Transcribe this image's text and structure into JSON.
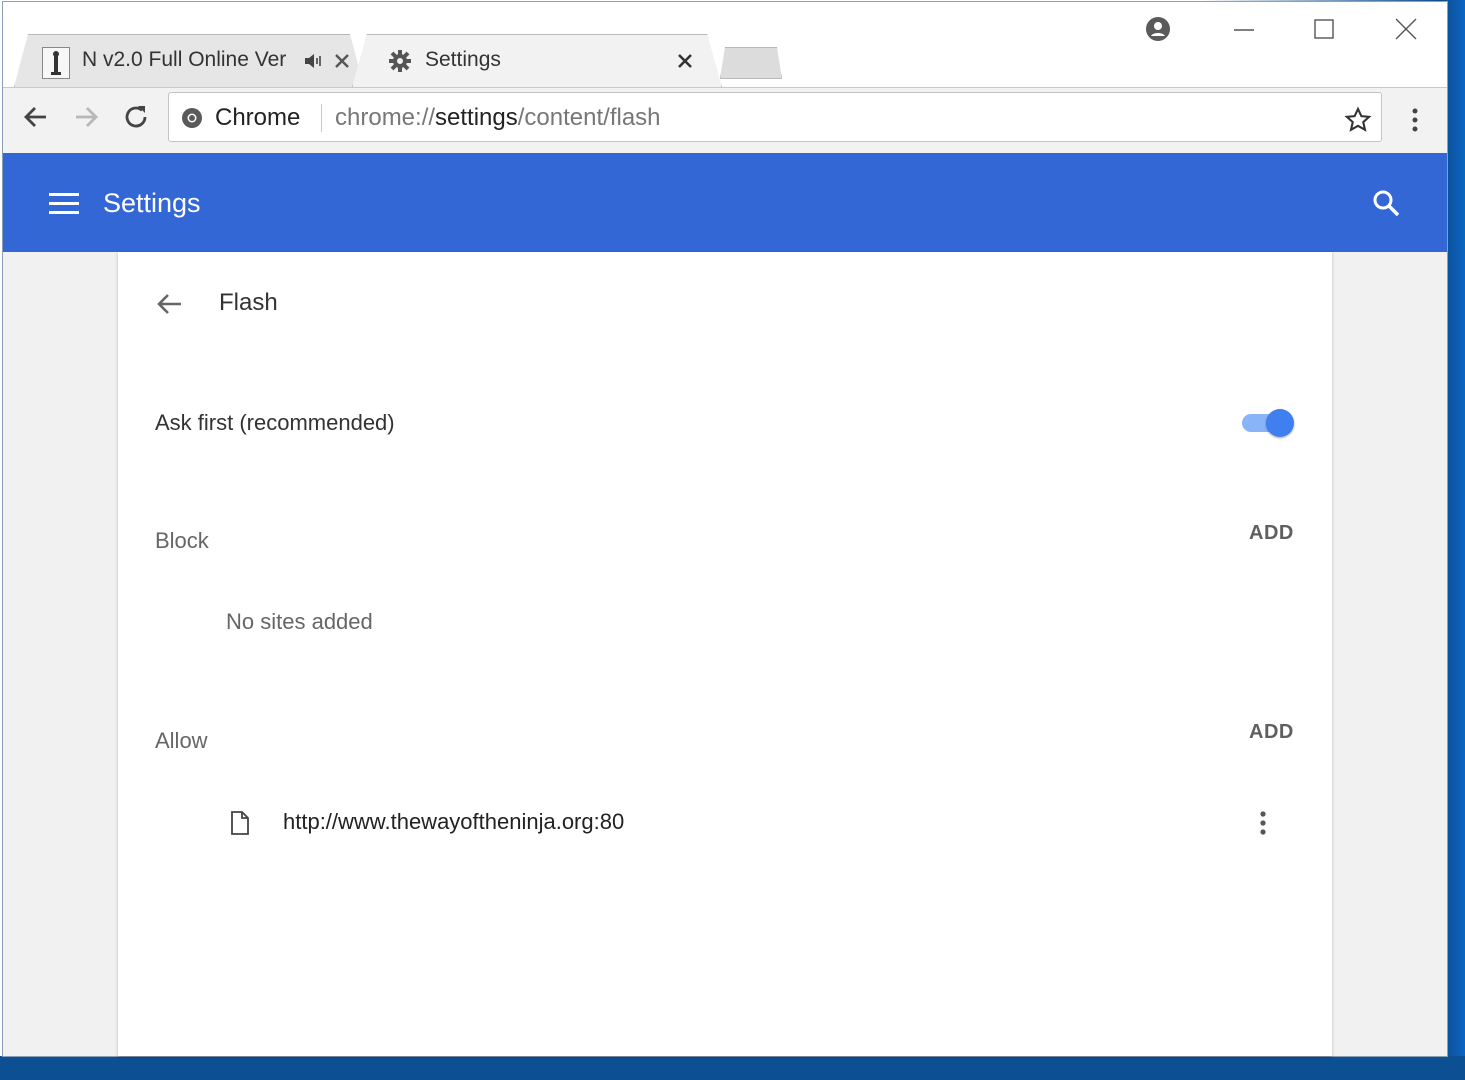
{
  "browser": {
    "tabs": [
      {
        "title": "N v2.0 Full Online Ver"
      },
      {
        "title": "Settings"
      }
    ],
    "omnibox": {
      "security_label": "Chrome",
      "url_prefix": "chrome://",
      "url_host": "settings",
      "url_path": "/content/flash"
    }
  },
  "header": {
    "title": "Settings"
  },
  "page": {
    "title": "Flash",
    "ask_first": {
      "label": "Ask first (recommended)",
      "enabled": true
    },
    "block": {
      "label": "Block",
      "add_label": "ADD",
      "empty_text": "No sites added"
    },
    "allow": {
      "label": "Allow",
      "add_label": "ADD",
      "sites": [
        "http://www.thewayoftheninja.org:80"
      ]
    }
  },
  "colors": {
    "header": "#3367d6",
    "toggle_on": "#3f7ff0"
  }
}
